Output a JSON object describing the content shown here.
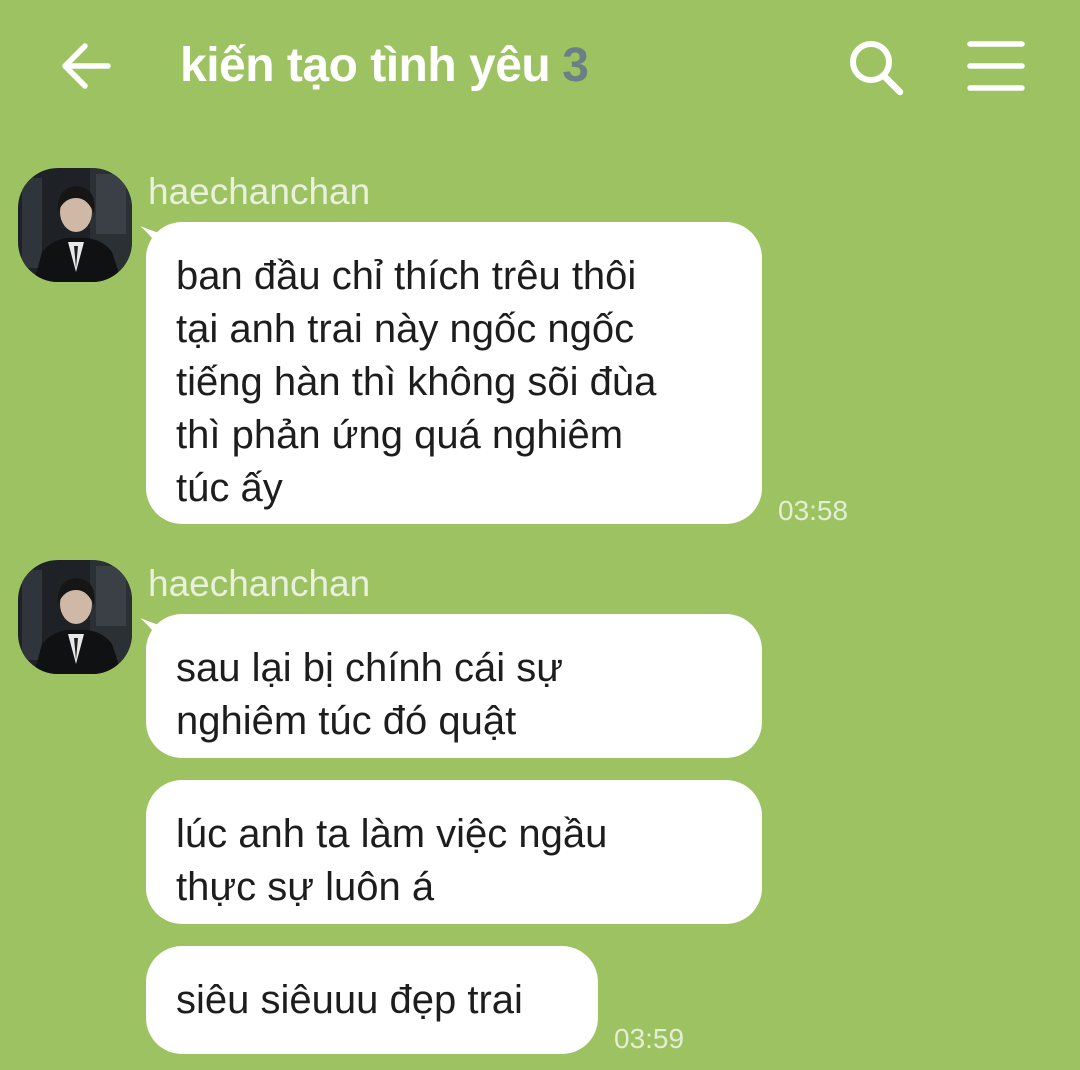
{
  "header": {
    "title": "kiến tạo tình yêu",
    "member_count": "3"
  },
  "colors": {
    "background": "#9cc261",
    "bubble": "#ffffff",
    "text": "#1d1d1d",
    "member_count": "#6b7f86",
    "meta_text": "#e3eed3"
  },
  "icons": {
    "back": "arrow-left-icon",
    "search": "search-icon",
    "menu": "hamburger-menu-icon"
  },
  "messages": [
    {
      "sender": "haechanchan",
      "lines": [
        "ban đầu chỉ thích trêu thôi",
        "tại anh trai này ngốc ngốc",
        "tiếng hàn thì không sõi đùa",
        "thì phản ứng quá nghiêm",
        "túc ấy"
      ],
      "time": "03:58"
    },
    {
      "sender": "haechanchan",
      "lines": [
        "sau lại bị chính cái sự",
        "nghiêm túc đó quật"
      ]
    },
    {
      "lines": [
        "lúc anh ta làm việc ngầu",
        "thực sự luôn á"
      ]
    },
    {
      "lines": [
        "siêu siêuuu đẹp trai"
      ],
      "time": "03:59"
    }
  ]
}
